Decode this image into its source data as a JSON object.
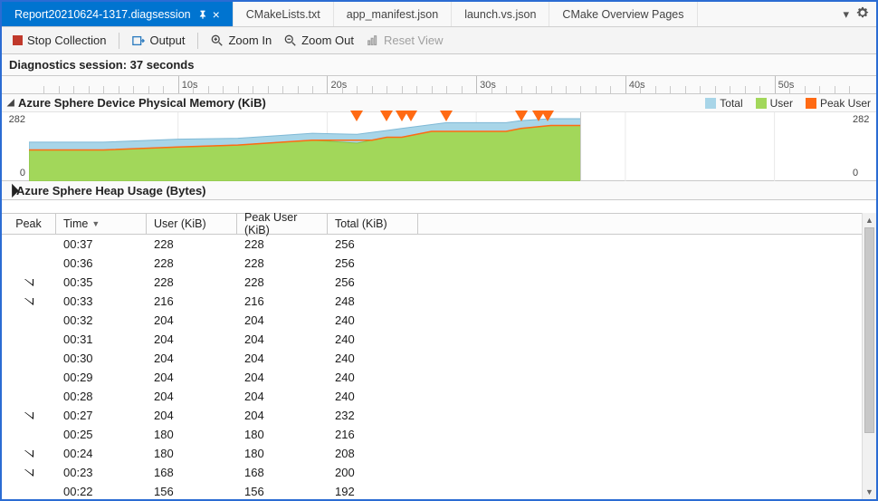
{
  "tabs": {
    "active": "Report20210624-1317.diagsession",
    "others": [
      "CMakeLists.txt",
      "app_manifest.json",
      "launch.vs.json",
      "CMake Overview Pages"
    ]
  },
  "toolbar": {
    "stop": "Stop Collection",
    "output": "Output",
    "zoom_in": "Zoom In",
    "zoom_out": "Zoom Out",
    "reset": "Reset View"
  },
  "session_header": "Diagnostics session: 37 seconds",
  "ruler_ticks": [
    "10s",
    "20s",
    "30s",
    "40s",
    "50s"
  ],
  "section": {
    "title": "Azure Sphere Device Physical Memory (KiB)",
    "collapsed_title": "Azure Sphere Heap Usage (Bytes)",
    "legend": {
      "total": "Total",
      "user": "User",
      "peak_user": "Peak User"
    },
    "colors": {
      "total": "#a8d5e8",
      "user": "#a2d75a",
      "peak_user": "#ff6a13"
    },
    "ymax": "282",
    "ymin": "0"
  },
  "chart_data": {
    "type": "area",
    "title": "Azure Sphere Device Physical Memory (KiB)",
    "xlabel": "seconds",
    "ylabel": "KiB",
    "xlim": [
      0,
      55
    ],
    "ylim": [
      0,
      282
    ],
    "end_x": 37,
    "x": [
      0,
      5,
      10,
      14,
      17,
      19,
      22,
      23,
      24,
      25,
      27,
      28,
      29,
      30,
      31,
      32,
      33,
      35,
      36,
      37
    ],
    "series": [
      {
        "name": "Total",
        "color": "#a8d5e8",
        "values": [
          160,
          160,
          172,
          176,
          188,
          196,
          192,
          200,
          208,
          216,
          232,
          240,
          240,
          240,
          240,
          240,
          248,
          256,
          256,
          256
        ]
      },
      {
        "name": "User",
        "color": "#a2d75a",
        "values": [
          128,
          128,
          140,
          148,
          160,
          168,
          156,
          168,
          180,
          180,
          204,
          204,
          204,
          204,
          204,
          204,
          216,
          228,
          228,
          228
        ]
      },
      {
        "name": "Peak User",
        "color": "#ff6a13",
        "values": [
          128,
          128,
          140,
          148,
          160,
          168,
          168,
          168,
          180,
          180,
          204,
          204,
          204,
          204,
          204,
          204,
          216,
          228,
          228,
          228
        ]
      }
    ],
    "markers_x": [
      22,
      24,
      25,
      25.6,
      28,
      33,
      34.2,
      34.8
    ]
  },
  "table": {
    "columns": {
      "peak": "Peak",
      "time": "Time",
      "user": "User (KiB)",
      "peak_user": "Peak User (KiB)",
      "total": "Total (KiB)"
    },
    "rows": [
      {
        "peak": false,
        "time": "00:37",
        "user": "228",
        "peak_user": "228",
        "total": "256"
      },
      {
        "peak": false,
        "time": "00:36",
        "user": "228",
        "peak_user": "228",
        "total": "256"
      },
      {
        "peak": true,
        "time": "00:35",
        "user": "228",
        "peak_user": "228",
        "total": "256"
      },
      {
        "peak": true,
        "time": "00:33",
        "user": "216",
        "peak_user": "216",
        "total": "248"
      },
      {
        "peak": false,
        "time": "00:32",
        "user": "204",
        "peak_user": "204",
        "total": "240"
      },
      {
        "peak": false,
        "time": "00:31",
        "user": "204",
        "peak_user": "204",
        "total": "240"
      },
      {
        "peak": false,
        "time": "00:30",
        "user": "204",
        "peak_user": "204",
        "total": "240"
      },
      {
        "peak": false,
        "time": "00:29",
        "user": "204",
        "peak_user": "204",
        "total": "240"
      },
      {
        "peak": false,
        "time": "00:28",
        "user": "204",
        "peak_user": "204",
        "total": "240"
      },
      {
        "peak": true,
        "time": "00:27",
        "user": "204",
        "peak_user": "204",
        "total": "232"
      },
      {
        "peak": false,
        "time": "00:25",
        "user": "180",
        "peak_user": "180",
        "total": "216"
      },
      {
        "peak": true,
        "time": "00:24",
        "user": "180",
        "peak_user": "180",
        "total": "208"
      },
      {
        "peak": true,
        "time": "00:23",
        "user": "168",
        "peak_user": "168",
        "total": "200"
      },
      {
        "peak": false,
        "time": "00:22",
        "user": "156",
        "peak_user": "156",
        "total": "192"
      }
    ]
  }
}
